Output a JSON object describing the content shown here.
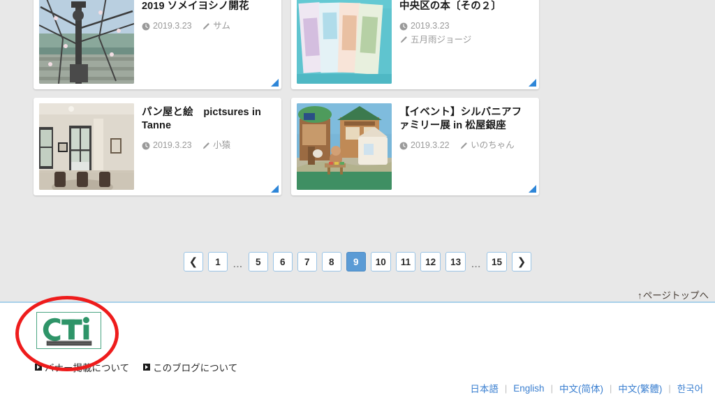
{
  "background_color": "#e8e8e8",
  "accent_color": "#5b9bd5",
  "link_color": "#3a7fd0",
  "logo_color": "#2e9468",
  "annotation": {
    "shape": "ellipse",
    "color": "#ee1c1c",
    "target": "cti-footer-logo"
  },
  "cards": {
    "clipped_row": [
      {
        "title": "",
        "date": "",
        "author": ""
      },
      {
        "title": "",
        "date": "",
        "author": ""
      }
    ],
    "rows": [
      [
        {
          "title": "2019 ソメイヨシノ開花",
          "date": "2019.3.23",
          "author": "サム",
          "meta_layout": "inline",
          "thumb": "cherry-blossom-bridge-photo"
        },
        {
          "title": "中央区の本〔その２〕",
          "date": "2019.3.23",
          "author": "五月雨ジョージ",
          "meta_layout": "stacked",
          "thumb": "japanese-books-photo"
        }
      ],
      [
        {
          "title": "パン屋と絵　pictsures in Tanne",
          "date": "2019.3.23",
          "author": "小猿",
          "meta_layout": "inline",
          "thumb": "cafe-interior-photo"
        },
        {
          "title": "【イベント】シルバニアファミリー展 in 松屋銀座",
          "date": "2019.3.22",
          "author": "いのちゃん",
          "meta_layout": "inline",
          "thumb": "sylvanian-families-diorama-photo"
        }
      ]
    ]
  },
  "pagination": {
    "prev_label": "❮",
    "next_label": "❯",
    "ellipsis": "...",
    "current_page": "9",
    "items": [
      {
        "type": "page",
        "label": "1",
        "active": false
      },
      {
        "type": "ellipsis",
        "label": "..."
      },
      {
        "type": "page",
        "label": "5",
        "active": false
      },
      {
        "type": "page",
        "label": "6",
        "active": false
      },
      {
        "type": "page",
        "label": "7",
        "active": false
      },
      {
        "type": "page",
        "label": "8",
        "active": false
      },
      {
        "type": "page",
        "label": "9",
        "active": true
      },
      {
        "type": "page",
        "label": "10",
        "active": false
      },
      {
        "type": "page",
        "label": "11",
        "active": false
      },
      {
        "type": "page",
        "label": "12",
        "active": false
      },
      {
        "type": "page",
        "label": "13",
        "active": false
      },
      {
        "type": "ellipsis",
        "label": "..."
      },
      {
        "type": "page",
        "label": "15",
        "active": false
      }
    ]
  },
  "page_top": {
    "arrow": "↑",
    "label": "ページトップへ"
  },
  "footer": {
    "logo": {
      "wordmark": "CTi",
      "subtext": "建設技術研究所",
      "prefix": "㈱"
    },
    "links": [
      {
        "label": "バナー掲載について"
      },
      {
        "label": "このブログについて"
      }
    ],
    "languages": [
      {
        "label": "日本語"
      },
      {
        "label": "English"
      },
      {
        "label": "中文(简体)"
      },
      {
        "label": "中文(繁體)"
      },
      {
        "label": "한국어"
      }
    ],
    "language_separator": "｜"
  },
  "icons": {
    "clock": "clock-icon",
    "pencil": "pencil-icon"
  }
}
